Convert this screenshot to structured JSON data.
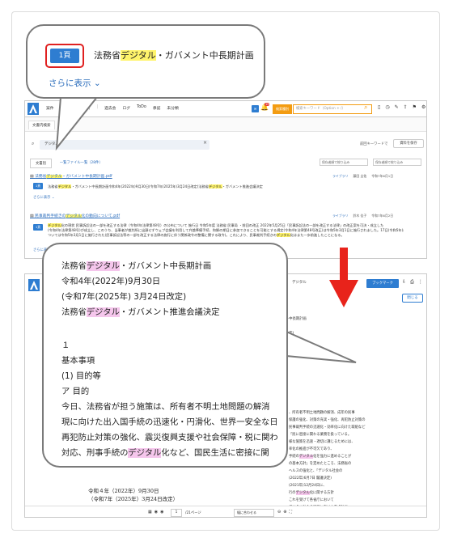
{
  "top_shot": {
    "menu": [
      "案件",
      "|",
      "程度",
      "分析",
      "|",
      "過去会",
      "ログ",
      "ToDo",
      "承認",
      "未分類"
    ],
    "bell_count": "19",
    "search_mode": "検索種別",
    "search_placeholder": "検索キーワード（Option + /）",
    "tab_label": "文書内検索",
    "query": "デジタル",
    "saved_label": "前回キーワードで",
    "save_button": "資料を保存",
    "view_tab_1": "文書別",
    "view_tab_2": "一覧ファイル一覧（28件）",
    "sort_1": "保存者順で絞り込み",
    "sort_2": "保存者順で絞り込み",
    "doc1": {
      "title_parts": [
        "法務省",
        "デジタル",
        "・ガバメント中長期計画.pdf"
      ],
      "library": "ライブラリ",
      "author": "藤田 圭佑",
      "date": "令和7年6月1日",
      "page": "1頁",
      "snippet_parts": [
        "法務省",
        "デジタル",
        "・ガバメント中長期計画令和4年(2022年)9月30日(令和7年(2025年)3月24日改定)法務省",
        "デジタル",
        "・ガバメント推進会議決定"
      ],
      "more": "さらに表示"
    },
    "doc2": {
      "title_parts": [
        "民事裁判手続きの",
        "デジタル",
        "化の動向について.pdf"
      ],
      "library": "ライブラリ",
      "author": "鈴木 佳子",
      "date": "令和7年6月2日",
      "page": "1頁",
      "snippet_line1_parts": [
        "デジタル",
        "化の現状 民事訴訟法の一部を改正する法律（令和4年法律第48号）の公布について 施行日 令和5年度 法務省 民事局 ・前回の改正 2022年5月25日「民事訴訟法の一部を改正する法律」の改正案を可決・成立した"
      ],
      "snippet_line2": "(令和4年法律第48号)が成立し、このうち、当事者が裁判所に出頭せずウェブ会議を利用して弁論準備手続、和解の期日に参加できることを可能とする規定(令和4年法律第48号改正)は令和5年3月1日に施行されました。17日(令和5年)に",
      "snippet_line3_parts": [
        "ついては令和5年3月1日に施行された(民事訴訟法等の一部を改正する法律の施行に伴う関係政令の整備に関する政令)。これにより、民事裁判手続きの",
        "デジタル",
        "化はまた一歩前進したことになる。"
      ],
      "more": "さらに表示"
    }
  },
  "bottom_shot": {
    "search_query": "デジタル",
    "search_sel": "1/50",
    "bookmark_button": "ブックマーク",
    "close_button": "閉じる",
    "pdf_right_lines": [
      "ト中長期計画",
      "",
      "改定)",
      "進会議決定",
      "",
      "",
      "",
      "",
      "、所有者不明土地問題の解消、成年の民事",
      "保護の強化、対策の充実・強化、再犯防止対策の",
      "民事裁判手続の迅速化・効率化に向けた取組など",
      "「民に密接に関わる業務を扱っている。",
      "様な施策を迅速・適切に講じるためには、",
      "率化の推進が不可欠であり、",
      "手続の",
      "デジタル",
      "化を強力に進めることが",
      "の基本方針」を定めたところ、法務省の",
      "ヘルスの強化と、「デジタル",
      "社会の",
      "(2022年)6月7日 閣議決定)",
      "(2021年)12月24日に、",
      "行の",
      "デジタル",
      "化に関する方針",
      "これを受けて各省庁において",
      "デジタル",
      "社会の実現に向けた重点計画"
    ],
    "pdf_left_title": "令和４年（2022年）9月30日",
    "pdf_left_sub": "（令和7年（2025年）3月24日改定）",
    "page_input": "1",
    "page_total": "/21ページ",
    "fit_select": "幅に合わせる"
  },
  "callout_top": {
    "page_button": "1頁",
    "title_parts": [
      "法務省",
      "デジタル",
      "・ガバメント中長期計画"
    ],
    "more_label": "さらに表示",
    "more_chevron": "chevron-down-icon"
  },
  "callout_mid": {
    "line1_parts": [
      "法務省",
      "デジタル",
      "・ガバメント中長期計画"
    ],
    "line2": "令和4年(2022年)9月30日",
    "line3": "(令和7年(2025年) 3月24日改定)",
    "line4_parts": [
      "法務省",
      "デジタル",
      "・ガバメント推進会議決定"
    ],
    "line5": "１",
    "line6": "基本事項",
    "line7": "(1) 目的等",
    "line8": "ア 目的",
    "line9": "今日、法務省が担う施策は、所有者不明土地問題の解消",
    "line10": "現に向けた出入国手続の迅速化・円滑化、世界一安全な日",
    "line11": "再犯防止対策の強化、震災復興支援や社会保障・税に関わ",
    "line12_parts": [
      "対応、刑事手続の",
      "デジタル",
      "化など、国民生活に密接に関"
    ]
  },
  "colors": {
    "accent_blue": "#2e7dd1",
    "highlight_yellow": "#fff46b",
    "highlight_pink": "#f5c6ec",
    "arrow_red": "#e8231b",
    "search_orange": "#f39c12"
  }
}
